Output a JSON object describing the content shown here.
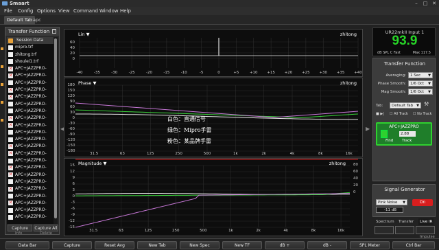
{
  "window": {
    "title": "Smaart",
    "controls": [
      "–",
      "□",
      "✕"
    ]
  },
  "menu": [
    "File",
    "Config",
    "Options",
    "View",
    "Command",
    "Window",
    "Help"
  ],
  "tabs": [
    {
      "label": "Default Tab",
      "active": true
    },
    {
      "label": "apc",
      "active": false
    }
  ],
  "left_panel": {
    "title": "Transfer Function",
    "session_label": "Session Data",
    "items": [
      {
        "label": "mipro.trf",
        "icon": "file-icon"
      },
      {
        "label": "zhitong.trf",
        "icon": "file-icon"
      },
      {
        "label": "shoulei1.trf",
        "icon": "file-icon"
      },
      {
        "label": "APC+JAZZPRO-",
        "icon": "disabled-x-icon"
      },
      {
        "label": "APC+JAZZPRO-",
        "icon": "disabled-x-icon"
      },
      {
        "label": "APC+JAZZPRO-",
        "icon": "file-icon"
      },
      {
        "label": "APC+JAZZPRO-",
        "icon": "disabled-x-icon"
      },
      {
        "label": "APC+JAZZPRO-",
        "icon": "disabled-x-icon"
      },
      {
        "label": "APC+JAZZPRO-",
        "icon": "file-icon"
      },
      {
        "label": "APC+JAZZPRO-",
        "icon": "file-icon"
      },
      {
        "label": "APC+JAZZPRO-",
        "icon": "disabled-x-icon"
      },
      {
        "label": "APC+JAZZPRO-",
        "icon": "disabled-x-icon"
      },
      {
        "label": "APC+JAZZPRO-",
        "icon": "file-icon"
      },
      {
        "label": "APC+JAZZPRO-",
        "icon": "file-icon"
      },
      {
        "label": "APC+JAZZPRO-",
        "icon": "disabled-x-icon"
      },
      {
        "label": "APC+JAZZPRO-",
        "icon": "disabled-x-icon"
      },
      {
        "label": "APC+JAZZPRO-",
        "icon": "file-icon"
      },
      {
        "label": "APC+JAZZPRO-",
        "icon": "disabled-x-icon"
      },
      {
        "label": "APC+JAZZPRO-",
        "icon": "disabled-x-icon"
      },
      {
        "label": "APC+JAZZPRO-",
        "icon": "file-icon"
      },
      {
        "label": "APC+JAZZPRO-",
        "icon": "disabled-x-icon"
      },
      {
        "label": "APC+JAZZPRO-",
        "icon": "file-icon"
      },
      {
        "label": "APC+JAZZPRO-",
        "icon": "disabled-x-icon"
      },
      {
        "label": "APC+JAZZPRO-",
        "icon": "file-icon"
      },
      {
        "label": "APC+JAZZPRO-",
        "icon": "file-icon"
      }
    ],
    "capture_label": "Capture",
    "capture_all_label": "Capture All",
    "info_label": "Info",
    "delete_label": "Delete"
  },
  "plots": {
    "lin": {
      "name": "Lin",
      "ref": "zhitong",
      "x_ticks": [
        "-40",
        "-35",
        "-30",
        "-25",
        "-20",
        "-15",
        "-10",
        "-5",
        "0",
        "+5",
        "+10",
        "+15",
        "+20",
        "+25",
        "+30",
        "+35",
        "+40"
      ],
      "y_ticks": [
        "60",
        "40",
        "20",
        "0"
      ]
    },
    "phase": {
      "name": "Phase",
      "ref": "zhitong",
      "y_ticks": [
        "180",
        "150",
        "120",
        "90",
        "60",
        "30",
        "0",
        "-30",
        "-60",
        "-90",
        "-120",
        "-150",
        "-180"
      ]
    },
    "magnitude": {
      "name": "Magnitude",
      "ref": "zhitong",
      "y_ticks": [
        "15",
        "12",
        "9",
        "6",
        "3",
        "0",
        "-3",
        "-6",
        "-9",
        "-12",
        "-15"
      ],
      "y_ticks_right": [
        "80",
        "60",
        "40",
        "20",
        "0"
      ],
      "x_ticks": [
        "31.5",
        "63",
        "125",
        "250",
        "500",
        "1k",
        "2k",
        "4k",
        "8k",
        "16k"
      ]
    },
    "phase_x_ticks": [
      "31.5",
      "63",
      "125",
      "250",
      "500",
      "1k",
      "2k",
      "4k",
      "8k",
      "16k"
    ],
    "annotations": [
      "白色：直通信号",
      "绿色：Mipro手雷",
      "粉色：某品牌手雷"
    ]
  },
  "meter": {
    "name": "UR22mkII Input 1",
    "value": "93.9",
    "unit": "dB SPL C Fast",
    "max": "Max 117.5"
  },
  "transfer_function": {
    "title": "Transfer Function",
    "averaging_label": "Averaging:",
    "averaging_value": "1 Sec",
    "phase_smooth_label": "Phase Smooth:",
    "phase_smooth_value": "1/6 Oct",
    "mag_smooth_label": "Mag Smooth:",
    "mag_smooth_value": "1/6 Oct",
    "tab_label": "Tab:",
    "tab_value": "Default Tab",
    "all_track": "All Track",
    "no_track": "No Track",
    "card_name": "APC+JAZZPRO",
    "card_value": "2.88",
    "find_label": "Find",
    "track_label": "Track"
  },
  "signal_generator": {
    "title": "Signal Generator",
    "noise": "Pink Noise",
    "level": "-11 dB",
    "on_label": "On"
  },
  "mode_tabs": [
    "Spectrum",
    "Transfer",
    "Live IR"
  ],
  "mode_labels": [
    "Impulse"
  ],
  "bottom_buttons": [
    "Data Bar",
    "Capture",
    "Reset Avg",
    "New Tab",
    "New Spec",
    "New TF",
    "dB +",
    "dB -",
    "SPL Meter",
    "Ctrl Bar"
  ],
  "colors": {
    "white_trace": "#e6e6e6",
    "green_trace": "#3ad23a",
    "pink_trace": "#c878d8",
    "meter_green": "#27d427",
    "on_red": "#d81e1e"
  }
}
